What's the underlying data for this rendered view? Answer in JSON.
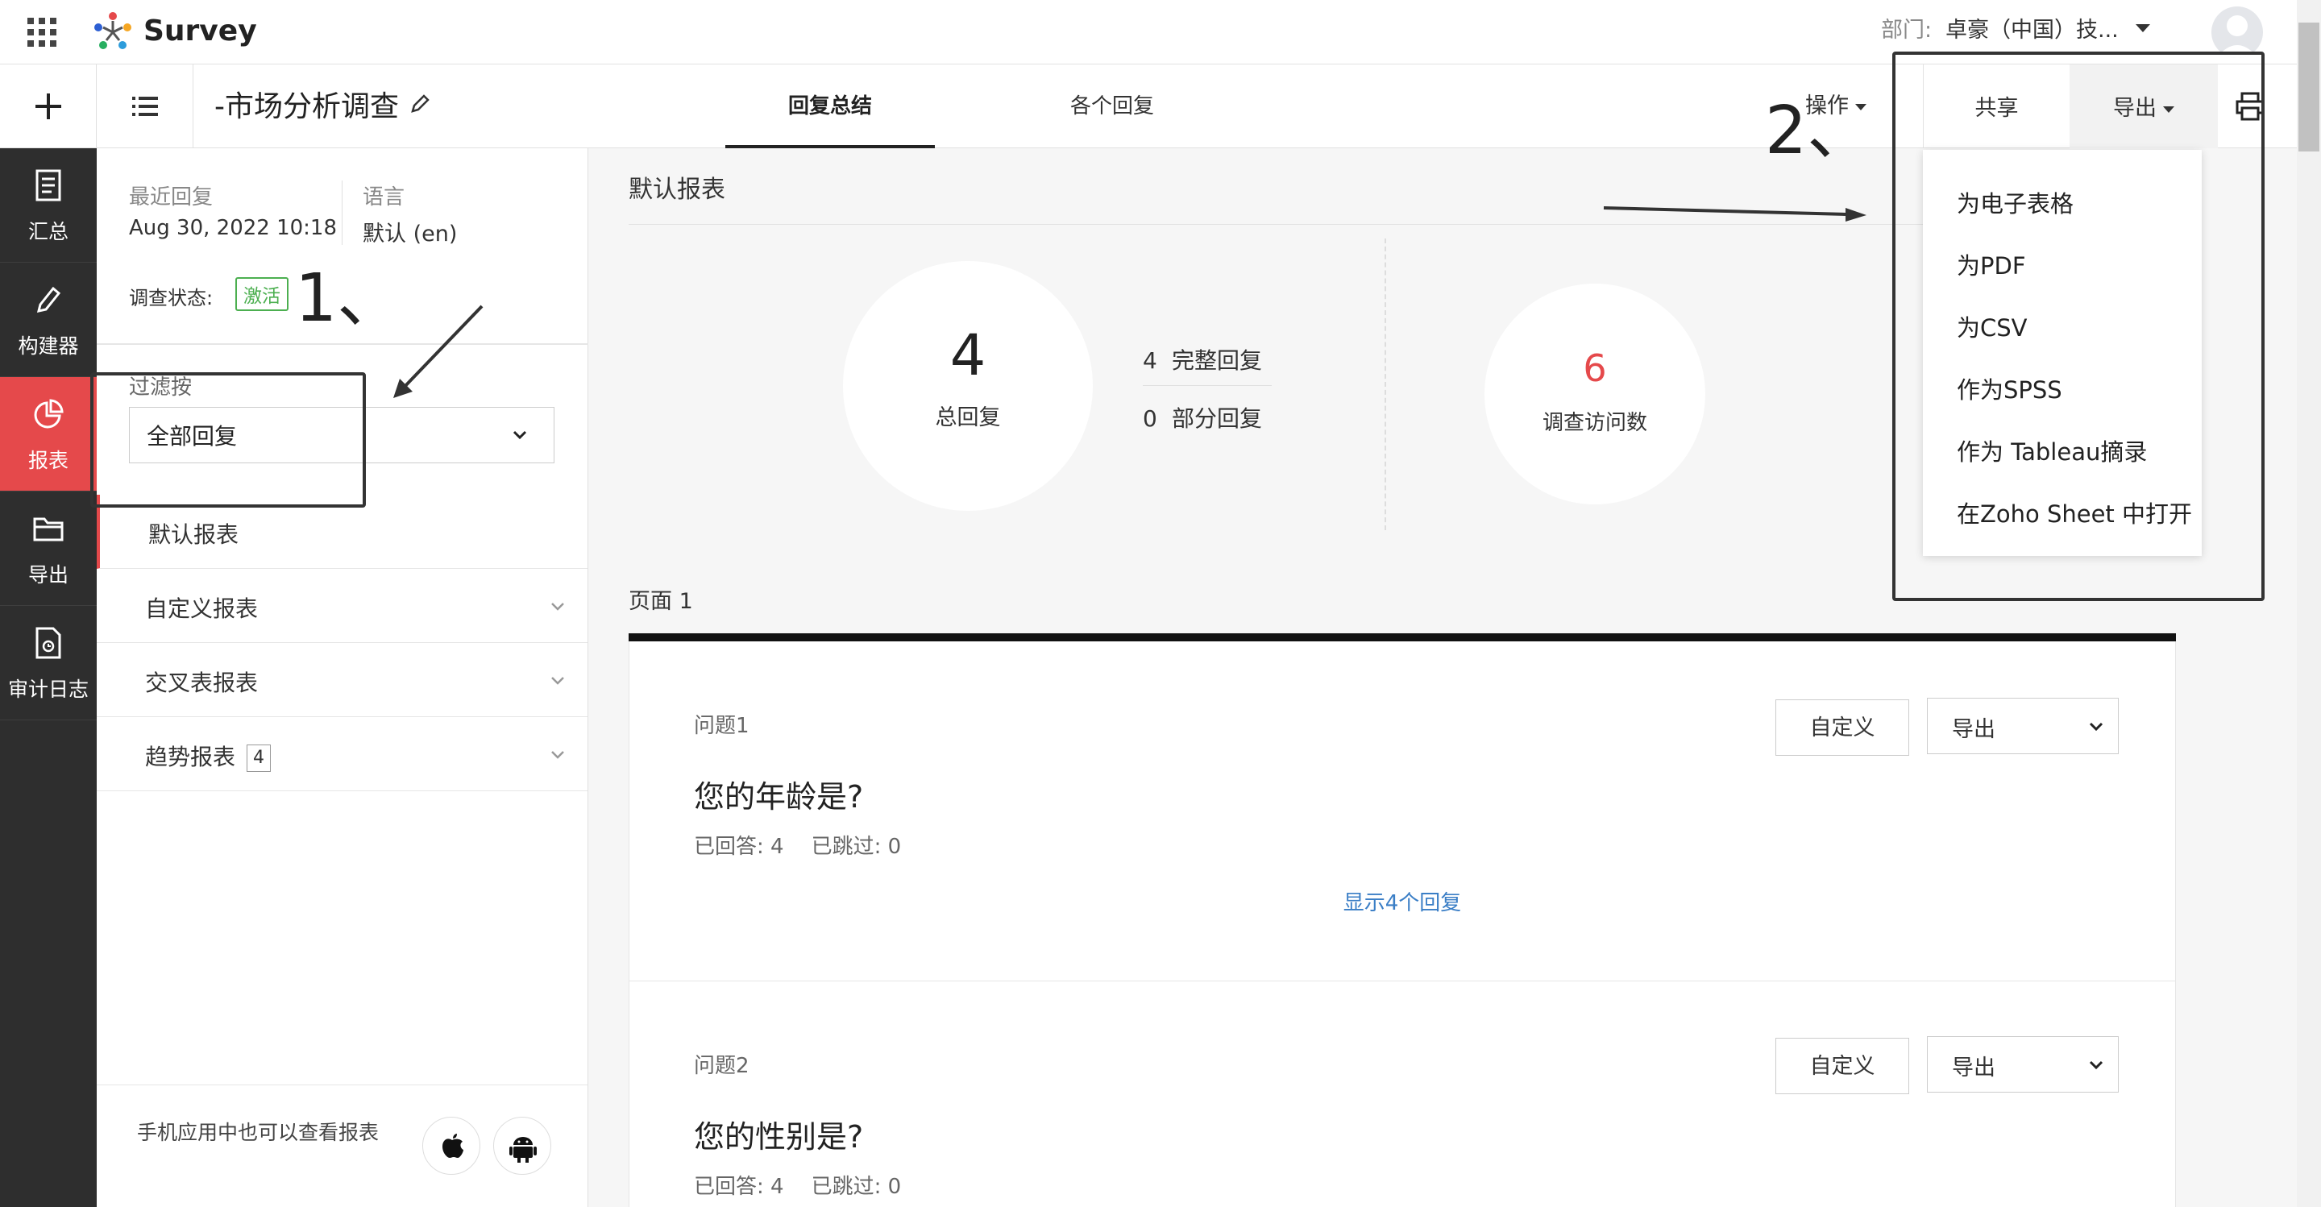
{
  "topbar": {
    "app_name": "Survey",
    "department_label": "部门:",
    "department_value": "卓豪（中国）技..."
  },
  "subbar": {
    "survey_title": "-市场分析调查",
    "tabs": [
      {
        "label": "回复总结",
        "active": true
      },
      {
        "label": "各个回复",
        "active": false
      }
    ],
    "actions_label": "操作",
    "share_label": "共享",
    "export_label": "导出"
  },
  "nav": {
    "items": [
      {
        "label": "汇总",
        "icon": "summary-icon"
      },
      {
        "label": "构建器",
        "icon": "pencil-icon"
      },
      {
        "label": "报表",
        "icon": "pie-chart-icon",
        "active": true
      },
      {
        "label": "导出",
        "icon": "folder-icon"
      },
      {
        "label": "审计日志",
        "icon": "audit-log-icon"
      }
    ]
  },
  "panel": {
    "last_response_label": "最近回复",
    "last_response_value": "Aug 30, 2022 10:18",
    "language_label": "语言",
    "language_value": "默认 (en)",
    "status_label": "调查状态:",
    "status_value": "激活",
    "filter_label": "过滤按",
    "filter_value": "全部回复",
    "reports": [
      {
        "label": "默认报表"
      },
      {
        "label": "自定义报表"
      },
      {
        "label": "交叉表报表"
      },
      {
        "label": "趋势报表",
        "count": "4"
      }
    ],
    "mobile_text": "手机应用中也可以查看报表"
  },
  "main": {
    "heading": "默认报表",
    "total_responses": "4",
    "total_label": "总回复",
    "complete_count": "4",
    "complete_label": "完整回复",
    "partial_count": "0",
    "partial_label": "部分回复",
    "visits": "6",
    "visits_label": "调查访问数",
    "page_label": "页面 1",
    "questions": [
      {
        "number": "问题1",
        "title": "您的年龄是?",
        "answered": "已回答:  4",
        "skipped": "已跳过:  0",
        "customize_label": "自定义",
        "export_label": "导出",
        "show_link": "显示4个回复"
      },
      {
        "number": "问题2",
        "title": "您的性别是?",
        "answered": "已回答:  4",
        "skipped": "已跳过:  0",
        "customize_label": "自定义",
        "export_label": "导出"
      }
    ]
  },
  "export_menu": {
    "items": [
      "为电子表格",
      "为PDF",
      "为CSV",
      "作为SPSS",
      "作为 Tableau摘录",
      "在Zoho Sheet 中打开"
    ]
  },
  "annotations": {
    "step1": "1、",
    "step2": "2、"
  },
  "colors": {
    "accent": "#e5494b",
    "nav_bg": "#2e2e2e",
    "active_badge": "#4caf50",
    "link": "#3a7ec6"
  }
}
